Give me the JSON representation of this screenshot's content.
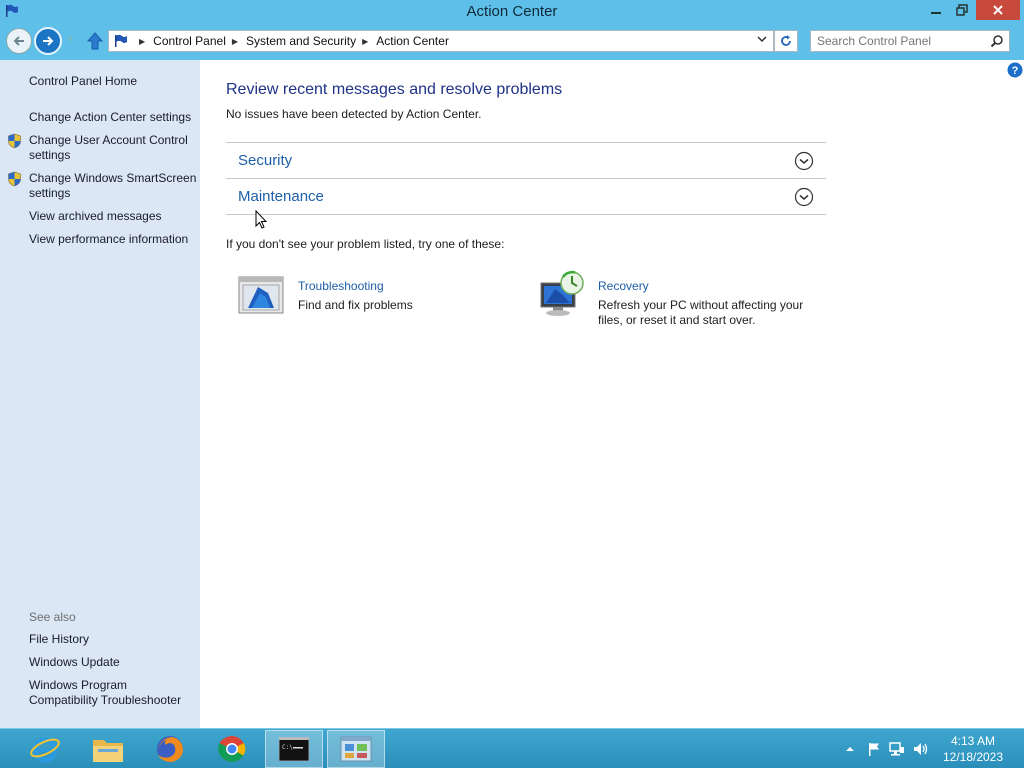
{
  "window": {
    "title": "Action Center"
  },
  "address": {
    "crumbs": [
      "Control Panel",
      "System and Security",
      "Action Center"
    ]
  },
  "search": {
    "placeholder": "Search Control Panel"
  },
  "sidebar": {
    "home": "Control Panel Home",
    "links": [
      "Change Action Center settings",
      "Change User Account Control settings",
      "Change Windows SmartScreen settings",
      "View archived messages",
      "View performance information"
    ],
    "see_also_label": "See also",
    "see_also": [
      "File History",
      "Windows Update",
      "Windows Program Compatibility Troubleshooter"
    ]
  },
  "main": {
    "title": "Review recent messages and resolve problems",
    "subtitle": "No issues have been detected by Action Center.",
    "sections": [
      "Security",
      "Maintenance"
    ],
    "try_text": "If you don't see your problem listed, try one of these:",
    "tasks": [
      {
        "title": "Troubleshooting",
        "description": "Find and fix problems"
      },
      {
        "title": "Recovery",
        "description": "Refresh your PC without affecting your files, or reset it and start over."
      }
    ]
  },
  "taskbar": {
    "apps": [
      "internet-explorer",
      "file-explorer",
      "firefox",
      "chrome",
      "command-prompt",
      "control-panel"
    ],
    "time": "4:13 AM",
    "date": "12/18/2023"
  },
  "colors": {
    "titlebar": "#5ec0e8",
    "sidebar": "#dbe7f5",
    "link": "#1e5fa8",
    "heading": "#1e3287"
  }
}
